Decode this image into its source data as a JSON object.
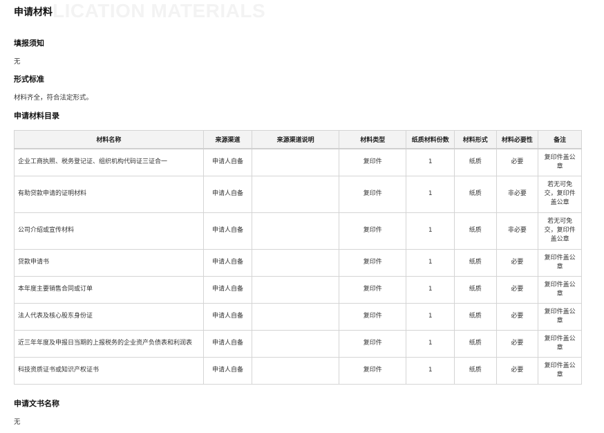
{
  "header": {
    "watermark": "LICATION MATERIALS",
    "title": "申请材料"
  },
  "sections": {
    "fill_notice": {
      "title": "填报须知",
      "text": "无"
    },
    "form_standard": {
      "title": "形式标准",
      "text": "材料齐全，符合法定形式。"
    },
    "catalog": {
      "title": "申请材料目录"
    },
    "doc_name": {
      "title": "申请文书名称",
      "text": "无"
    }
  },
  "table": {
    "headers": [
      "材料名称",
      "来源渠道",
      "来源渠道说明",
      "材料类型",
      "纸质材料份数",
      "材料形式",
      "材料必要性",
      "备注"
    ],
    "rows": [
      [
        "企业工商执照、税务登记证、组织机构代码证三证合一",
        "申请人自备",
        "",
        "复印件",
        "1",
        "纸质",
        "必要",
        "复印件盖公章"
      ],
      [
        "有助贷款申请的证明材料",
        "申请人自备",
        "",
        "复印件",
        "1",
        "纸质",
        "非必要",
        "若无可免交，复印件盖公章"
      ],
      [
        "公司介绍或宣传材料",
        "申请人自备",
        "",
        "复印件",
        "1",
        "纸质",
        "非必要",
        "若无可免交，复印件盖公章"
      ],
      [
        "贷款申请书",
        "申请人自备",
        "",
        "复印件",
        "1",
        "纸质",
        "必要",
        "复印件盖公章"
      ],
      [
        "本年度主要销售合同或订单",
        "申请人自备",
        "",
        "复印件",
        "1",
        "纸质",
        "必要",
        "复印件盖公章"
      ],
      [
        "法人代表及核心股东身份证",
        "申请人自备",
        "",
        "复印件",
        "1",
        "纸质",
        "必要",
        "复印件盖公章"
      ],
      [
        "近三年年度及申报日当期的上报税务的企业资产负债表和利润表",
        "申请人自备",
        "",
        "复印件",
        "1",
        "纸质",
        "必要",
        "复印件盖公章"
      ],
      [
        "科技资质证书或知识产权证书",
        "申请人自备",
        "",
        "复印件",
        "1",
        "纸质",
        "必要",
        "复印件盖公章"
      ]
    ]
  }
}
